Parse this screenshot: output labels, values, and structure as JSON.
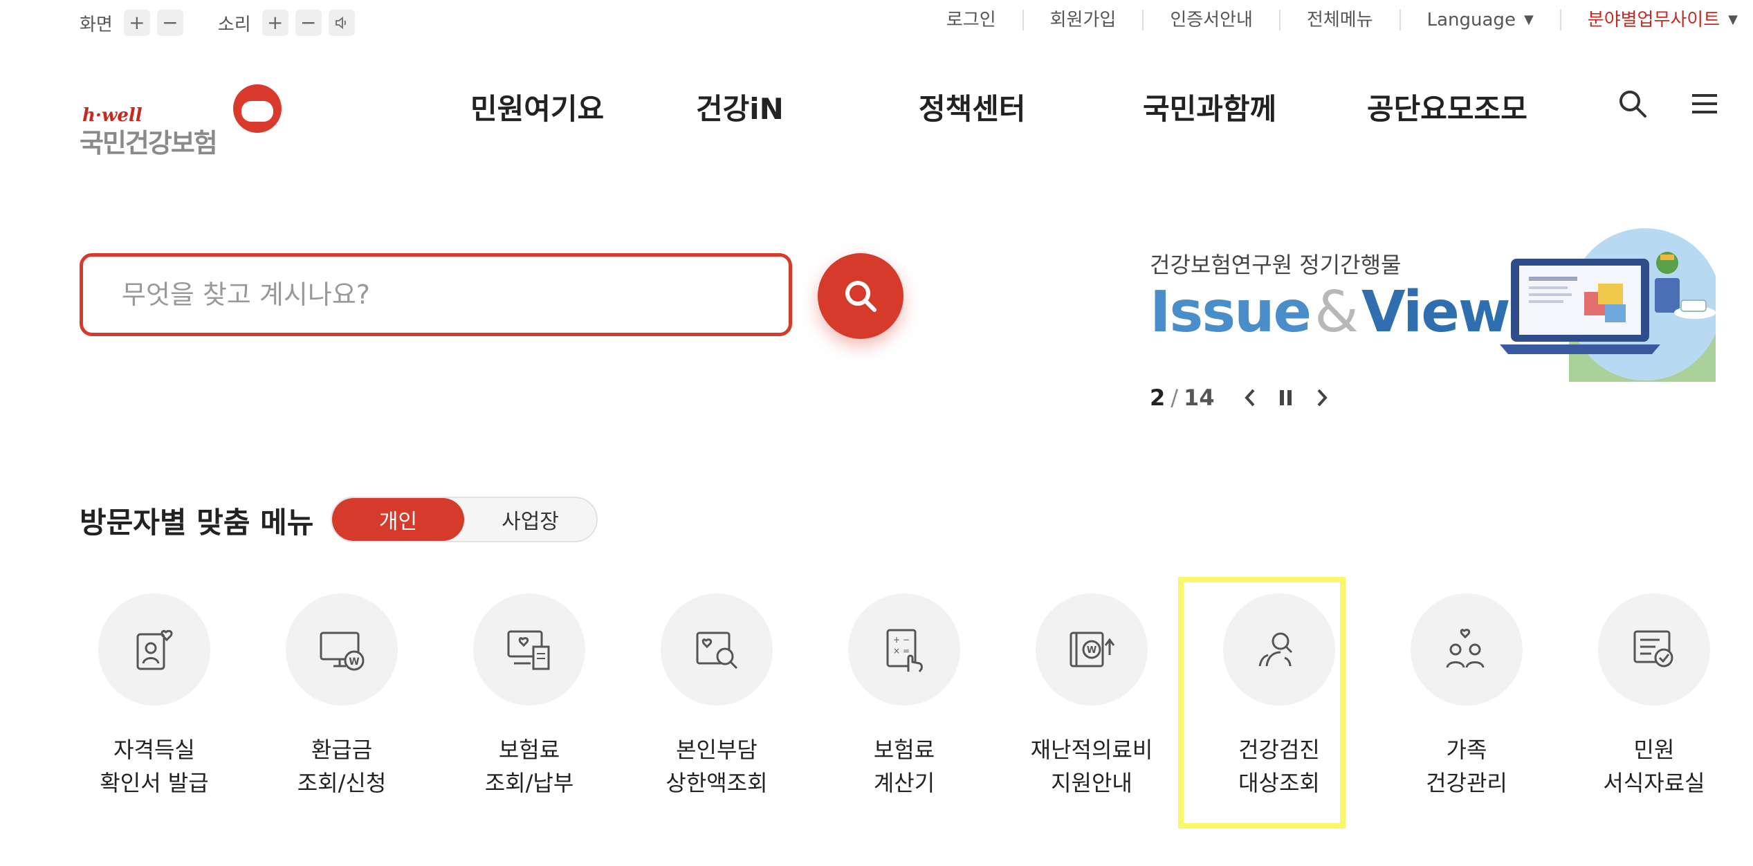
{
  "util": {
    "screen_label": "화면",
    "sound_label": "소리",
    "plus": "+",
    "minus": "−",
    "links": [
      "로그인",
      "회원가입",
      "인증서안내",
      "전체메뉴",
      "Language",
      "분야별업무사이트"
    ]
  },
  "logo": {
    "hwell": "h·well",
    "name": "국민건강보험"
  },
  "nav": [
    "민원여기요",
    "건강iN",
    "정책센터",
    "국민과함께",
    "공단요모조모"
  ],
  "search": {
    "placeholder": "무엇을 찾고 계시나요?"
  },
  "banner": {
    "subtitle": "건강보험연구원 정기간행물",
    "title_part1": "Issue",
    "title_amp": "&",
    "title_part2": "View",
    "page_current": "2",
    "page_sep": "/",
    "page_total": "14"
  },
  "visitor": {
    "title": "방문자별 맞춤 메뉴",
    "toggle": [
      "개인",
      "사업장"
    ],
    "active_toggle": "개인",
    "items": [
      {
        "line1": "자격득실",
        "line2": "확인서 발급",
        "icon": "person-card-heart-icon"
      },
      {
        "line1": "환급금",
        "line2": "조회/신청",
        "icon": "monitor-won-icon"
      },
      {
        "line1": "보험료",
        "line2": "조회/납부",
        "icon": "monitor-heart-receipt-icon"
      },
      {
        "line1": "본인부담",
        "line2": "상한액조회",
        "icon": "heart-search-icon"
      },
      {
        "line1": "보험료",
        "line2": "계산기",
        "icon": "calculator-hand-icon"
      },
      {
        "line1": "재난적의료비",
        "line2": "지원안내",
        "icon": "book-won-icon"
      },
      {
        "line1": "건강검진",
        "line2": "대상조회",
        "icon": "person-search-icon"
      },
      {
        "line1": "가족",
        "line2": "건강관리",
        "icon": "family-heart-icon"
      },
      {
        "line1": "민원",
        "line2": "서식자료실",
        "icon": "document-check-icon"
      }
    ]
  },
  "colors": {
    "brand_red": "#d63a2a",
    "highlight_yellow": "#fbf76a",
    "banner_blue": "#2f6fb0"
  }
}
